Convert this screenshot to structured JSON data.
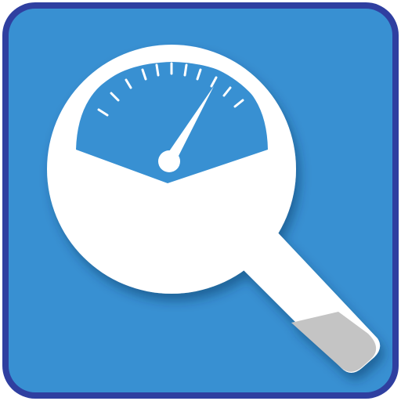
{
  "icon": {
    "semantic": "speed-test-magnifier-icon",
    "colors": {
      "border": "#2f3fa0",
      "tile": "#3890d2",
      "glyph": "#ffffff",
      "gauge": "#3890d2",
      "handle_cap": "#c4c4c4"
    }
  }
}
